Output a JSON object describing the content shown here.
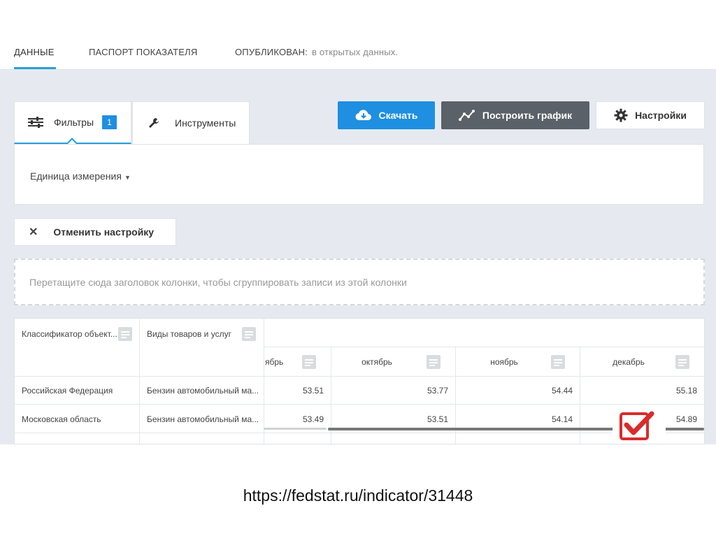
{
  "topnav": {
    "tab_data": "ДАННЫЕ",
    "tab_passport": "ПАСПОРТ ПОКАЗАТЕЛЯ",
    "published_label": "ОПУБЛИКОВАН:",
    "published_value": "в открытых данных."
  },
  "panel": {
    "filters_label": "Фильтры",
    "filters_count": "1",
    "tools_label": "Инструменты",
    "unit_label": "Единица измерения"
  },
  "toolbar": {
    "download_label": "Скачать",
    "chart_label": "Построить график",
    "settings_label": "Настройки"
  },
  "reset_label": "Отменить настройку",
  "dropzone_text": "Перетащите сюда заголовок колонки, чтобы сгруппировать записи из этой колонки",
  "grid": {
    "group_headers": [
      "Классификатор объект...",
      "Виды товаров и услуг"
    ],
    "month_headers": [
      "ябрь",
      "октябрь",
      "ноябрь",
      "декабрь"
    ],
    "rows": [
      {
        "region": "Российская Федерация",
        "product": "Бензин автомобильный ма...",
        "values": [
          "53.51",
          "53.77",
          "54.44",
          "55.18"
        ]
      },
      {
        "region": "Московская область",
        "product": "Бензин автомобильный ма...",
        "values": [
          "53.49",
          "53.51",
          "54.14",
          "54.89"
        ]
      }
    ]
  },
  "caption": "https://fedstat.ru/indicator/31448",
  "colors": {
    "accent": "#1e8fe1",
    "chart_button": "#5a6168",
    "workspace_bg": "#e6eaf0",
    "check_red": "#d92b2b"
  }
}
